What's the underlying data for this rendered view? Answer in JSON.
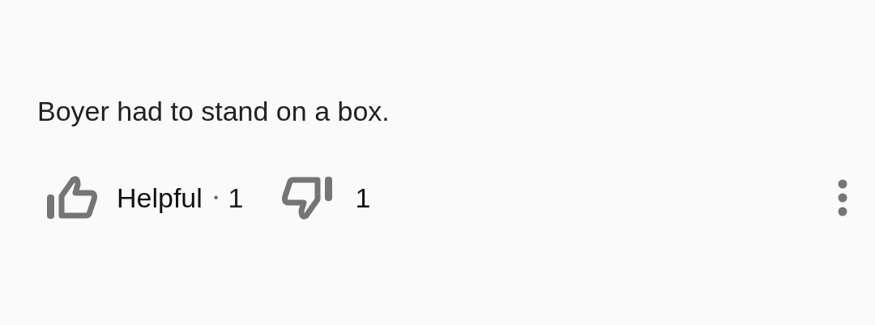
{
  "review": {
    "text": "Boyer had to stand on a box."
  },
  "actions": {
    "helpful": {
      "label": "Helpful",
      "separator": "•",
      "count": "1"
    },
    "not_helpful": {
      "count": "1"
    }
  }
}
